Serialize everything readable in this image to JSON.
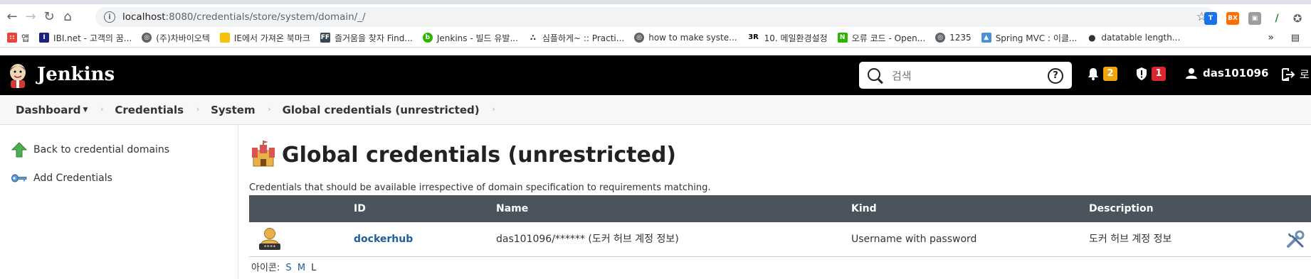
{
  "browser": {
    "url_host": "localhost",
    "url_rest": ":8080/credentials/store/system/domain/_/",
    "bookmarks": [
      {
        "label": "앱",
        "color": "#e8453c"
      },
      {
        "label": "IBI.net - 고객의 꿈...",
        "color": "#1a237e"
      },
      {
        "label": "(주)차바이오텍",
        "color": "#5f6368"
      },
      {
        "label": "IE에서 가져온 북마크",
        "color": "#f4c20d"
      },
      {
        "label": "즐거움을 찾자 Find...",
        "color": "#37474f"
      },
      {
        "label": "Jenkins - 빌드 유발...",
        "color": "#2db400"
      },
      {
        "label": "심플하게~ :: Practi...",
        "color": "#333333"
      },
      {
        "label": "how to make syste...",
        "color": "#5f6368"
      },
      {
        "label": "10. 메일환경설정",
        "color": "#222222"
      },
      {
        "label": "오류 코드 - Open...",
        "color": "#2db400"
      },
      {
        "label": "1235",
        "color": "#5f6368"
      },
      {
        "label": "Spring MVC : 이클...",
        "color": "#4a90d9"
      },
      {
        "label": "datatable length...",
        "color": "#333333"
      }
    ]
  },
  "header": {
    "brand": "Jenkins",
    "search_placeholder": "검색",
    "notifications_count": "2",
    "security_count": "1",
    "username": "das101096",
    "logout_label": "로"
  },
  "breadcrumb": [
    "Dashboard",
    "Credentials",
    "System",
    "Global credentials (unrestricted)"
  ],
  "side_panel": {
    "back_label": "Back to credential domains",
    "add_label": "Add Credentials"
  },
  "main": {
    "title": "Global credentials (unrestricted)",
    "description": "Credentials that should be available irrespective of domain specification to requirements matching.",
    "columns": [
      "ID",
      "Name",
      "Kind",
      "Description"
    ],
    "rows": [
      {
        "id": "dockerhub",
        "name": "das101096/****** (도커 허브 계정 정보)",
        "kind": "Username with password",
        "description": "도커 허브 계정 정보"
      }
    ],
    "icon_size_label": "아이콘:",
    "icon_sizes": [
      "S",
      "M",
      "L"
    ]
  },
  "colors": {
    "header_bg": "#000000",
    "table_header_bg": "#4b545c",
    "link": "#1d5e9c",
    "notification_badge": "#f0a30a",
    "security_badge": "#d9262f"
  }
}
